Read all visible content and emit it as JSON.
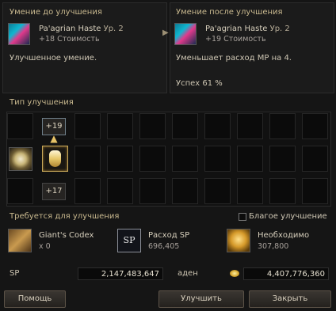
{
  "before": {
    "header": "Умение до улучшения",
    "skill_name": "Pa'agrian Haste",
    "skill_level": "Ур. 2",
    "cost": "+18 Стоимость",
    "description": "Улучшенное умение."
  },
  "after": {
    "header": "Умение после улучшения",
    "skill_name": "Pa'agrian Haste",
    "skill_level": "Ур. 2",
    "cost": "+19 Стоимость",
    "description": "Уменьшает расход MP на 4.",
    "success": "Успех 61 %"
  },
  "upgrade_type": {
    "header": "Тип улучшения",
    "options": [
      {
        "label": "+19",
        "selected": false
      },
      {
        "label": "",
        "selected": true,
        "icon": "potion-icon"
      },
      {
        "label": "+17",
        "selected": false
      }
    ],
    "left_icon": "magic-orb-icon"
  },
  "requirements": {
    "header": "Требуется для улучшения",
    "blessed_label": "Благое улучшение",
    "blessed_checked": false,
    "items": [
      {
        "name": "Giant's Codex",
        "value": "x 0",
        "icon": "book-icon"
      },
      {
        "name": "Расход SP",
        "value": "696,405",
        "icon": "sp-icon",
        "icon_text": "SP"
      },
      {
        "name": "Необходимо",
        "value": "307,800",
        "icon": "adena-icon"
      }
    ]
  },
  "stats": {
    "sp_label": "SP",
    "sp_value": "2,147,483,647",
    "adena_label": "аден",
    "adena_value": "4,407,776,360"
  },
  "buttons": {
    "help": "Помощь",
    "upgrade": "Улучшить",
    "close": "Закрыть"
  }
}
